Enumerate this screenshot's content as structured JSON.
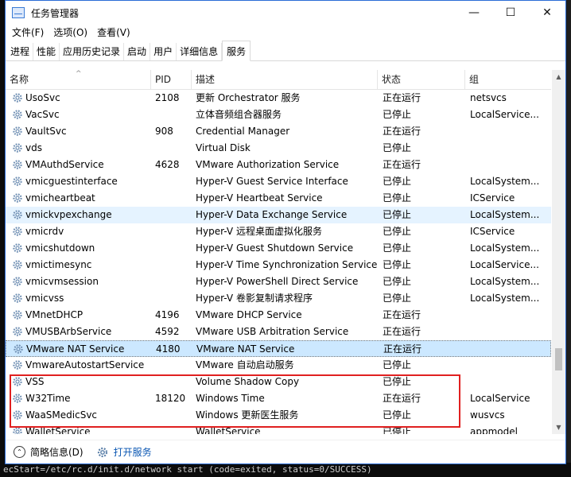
{
  "window": {
    "title": "任务管理器"
  },
  "controls": {
    "minimize": "—",
    "maximize": "☐",
    "close": "✕"
  },
  "menu": [
    "文件(F)",
    "选项(O)",
    "查看(V)"
  ],
  "tabs": [
    {
      "label": "进程",
      "active": false
    },
    {
      "label": "性能",
      "active": false
    },
    {
      "label": "应用历史记录",
      "active": false
    },
    {
      "label": "启动",
      "active": false
    },
    {
      "label": "用户",
      "active": false
    },
    {
      "label": "详细信息",
      "active": false
    },
    {
      "label": "服务",
      "active": true
    }
  ],
  "columns": {
    "name": "名称",
    "pid": "PID",
    "desc": "描述",
    "status": "状态",
    "group": "组",
    "sort_arrow": "^"
  },
  "services": [
    {
      "name": "UsoSvc",
      "pid": "2108",
      "desc": "更新 Orchestrator 服务",
      "status": "正在运行",
      "group": "netsvcs"
    },
    {
      "name": "VacSvc",
      "pid": "",
      "desc": "立体音频组合器服务",
      "status": "已停止",
      "group": "LocalService..."
    },
    {
      "name": "VaultSvc",
      "pid": "908",
      "desc": "Credential Manager",
      "status": "正在运行",
      "group": ""
    },
    {
      "name": "vds",
      "pid": "",
      "desc": "Virtual Disk",
      "status": "已停止",
      "group": ""
    },
    {
      "name": "VMAuthdService",
      "pid": "4628",
      "desc": "VMware Authorization Service",
      "status": "正在运行",
      "group": ""
    },
    {
      "name": "vmicguestinterface",
      "pid": "",
      "desc": "Hyper-V Guest Service Interface",
      "status": "已停止",
      "group": "LocalSystem..."
    },
    {
      "name": "vmicheartbeat",
      "pid": "",
      "desc": "Hyper-V Heartbeat Service",
      "status": "已停止",
      "group": "ICService"
    },
    {
      "name": "vmickvpexchange",
      "pid": "",
      "desc": "Hyper-V Data Exchange Service",
      "status": "已停止",
      "group": "LocalSystem..."
    },
    {
      "name": "vmicrdv",
      "pid": "",
      "desc": "Hyper-V 远程桌面虚拟化服务",
      "status": "已停止",
      "group": "ICService"
    },
    {
      "name": "vmicshutdown",
      "pid": "",
      "desc": "Hyper-V Guest Shutdown Service",
      "status": "已停止",
      "group": "LocalSystem..."
    },
    {
      "name": "vmictimesync",
      "pid": "",
      "desc": "Hyper-V Time Synchronization Service",
      "status": "已停止",
      "group": "LocalService..."
    },
    {
      "name": "vmicvmsession",
      "pid": "",
      "desc": "Hyper-V PowerShell Direct Service",
      "status": "已停止",
      "group": "LocalSystem..."
    },
    {
      "name": "vmicvss",
      "pid": "",
      "desc": "Hyper-V 卷影复制请求程序",
      "status": "已停止",
      "group": "LocalSystem..."
    },
    {
      "name": "VMnetDHCP",
      "pid": "4196",
      "desc": "VMware DHCP Service",
      "status": "正在运行",
      "group": ""
    },
    {
      "name": "VMUSBArbService",
      "pid": "4592",
      "desc": "VMware USB Arbitration Service",
      "status": "正在运行",
      "group": ""
    },
    {
      "name": "VMware NAT Service",
      "pid": "4180",
      "desc": "VMware NAT Service",
      "status": "正在运行",
      "group": ""
    },
    {
      "name": "VmwareAutostartService",
      "pid": "",
      "desc": "VMware 自动启动服务",
      "status": "已停止",
      "group": ""
    },
    {
      "name": "VSS",
      "pid": "",
      "desc": "Volume Shadow Copy",
      "status": "已停止",
      "group": ""
    },
    {
      "name": "W32Time",
      "pid": "18120",
      "desc": "Windows Time",
      "status": "正在运行",
      "group": "LocalService"
    },
    {
      "name": "WaaSMedicSvc",
      "pid": "",
      "desc": "Windows 更新医生服务",
      "status": "已停止",
      "group": "wusvcs"
    },
    {
      "name": "WalletService",
      "pid": "",
      "desc": "WalletService",
      "status": "已停止",
      "group": "appmodel"
    }
  ],
  "highlight": {
    "color": "#e02020"
  },
  "footer": {
    "summary": "简略信息(D)",
    "open_services": "打开服务"
  },
  "terminal": {
    "line": "ecStart=/etc/rc.d/init.d/network start (code=exited, status=0/SUCCESS)"
  },
  "colors": {
    "accent": "#2b6cd6",
    "link": "#0b57b3",
    "hover": "#e5f3ff",
    "selected": "#cce8ff"
  }
}
